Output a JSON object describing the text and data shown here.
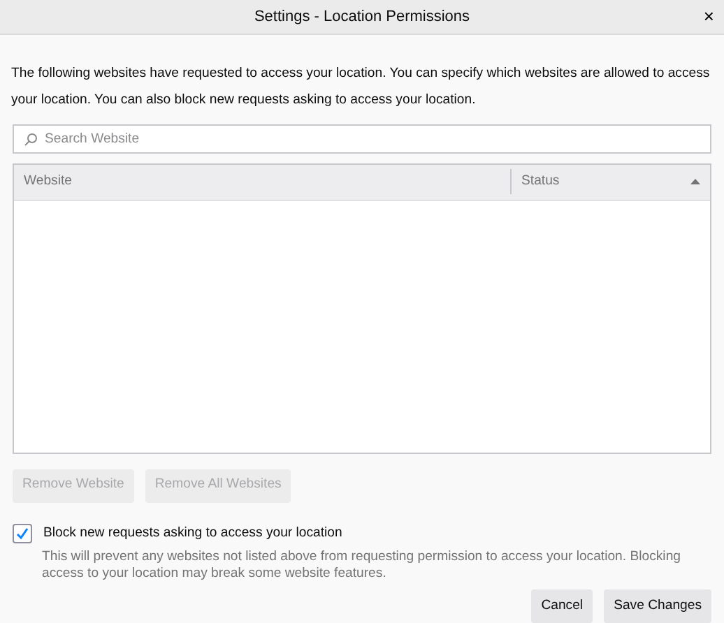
{
  "window": {
    "title": "Settings - Location Permissions",
    "close": "×"
  },
  "description": "The following websites have requested to access your location. You can specify which websites are allowed to access your location. You can also block new requests asking to access your location.",
  "search": {
    "placeholder": "Search Website"
  },
  "table": {
    "columns": [
      {
        "label": "Website",
        "sorted": false
      },
      {
        "label": "Status",
        "sorted": true
      }
    ]
  },
  "list_buttons": [
    {
      "label": "Remove Website",
      "disabled": true
    },
    {
      "label": "Remove All Websites",
      "disabled": true
    }
  ],
  "block_option": {
    "label": "Block new requests asking to access your location",
    "checked": true,
    "note": "This will prevent any websites not listed above from requesting permission to access your location. Blocking access to your location may break some website features."
  },
  "footer_buttons": [
    {
      "label": "Cancel",
      "disabled": false
    },
    {
      "label": "Save Changes",
      "disabled": false
    }
  ]
}
